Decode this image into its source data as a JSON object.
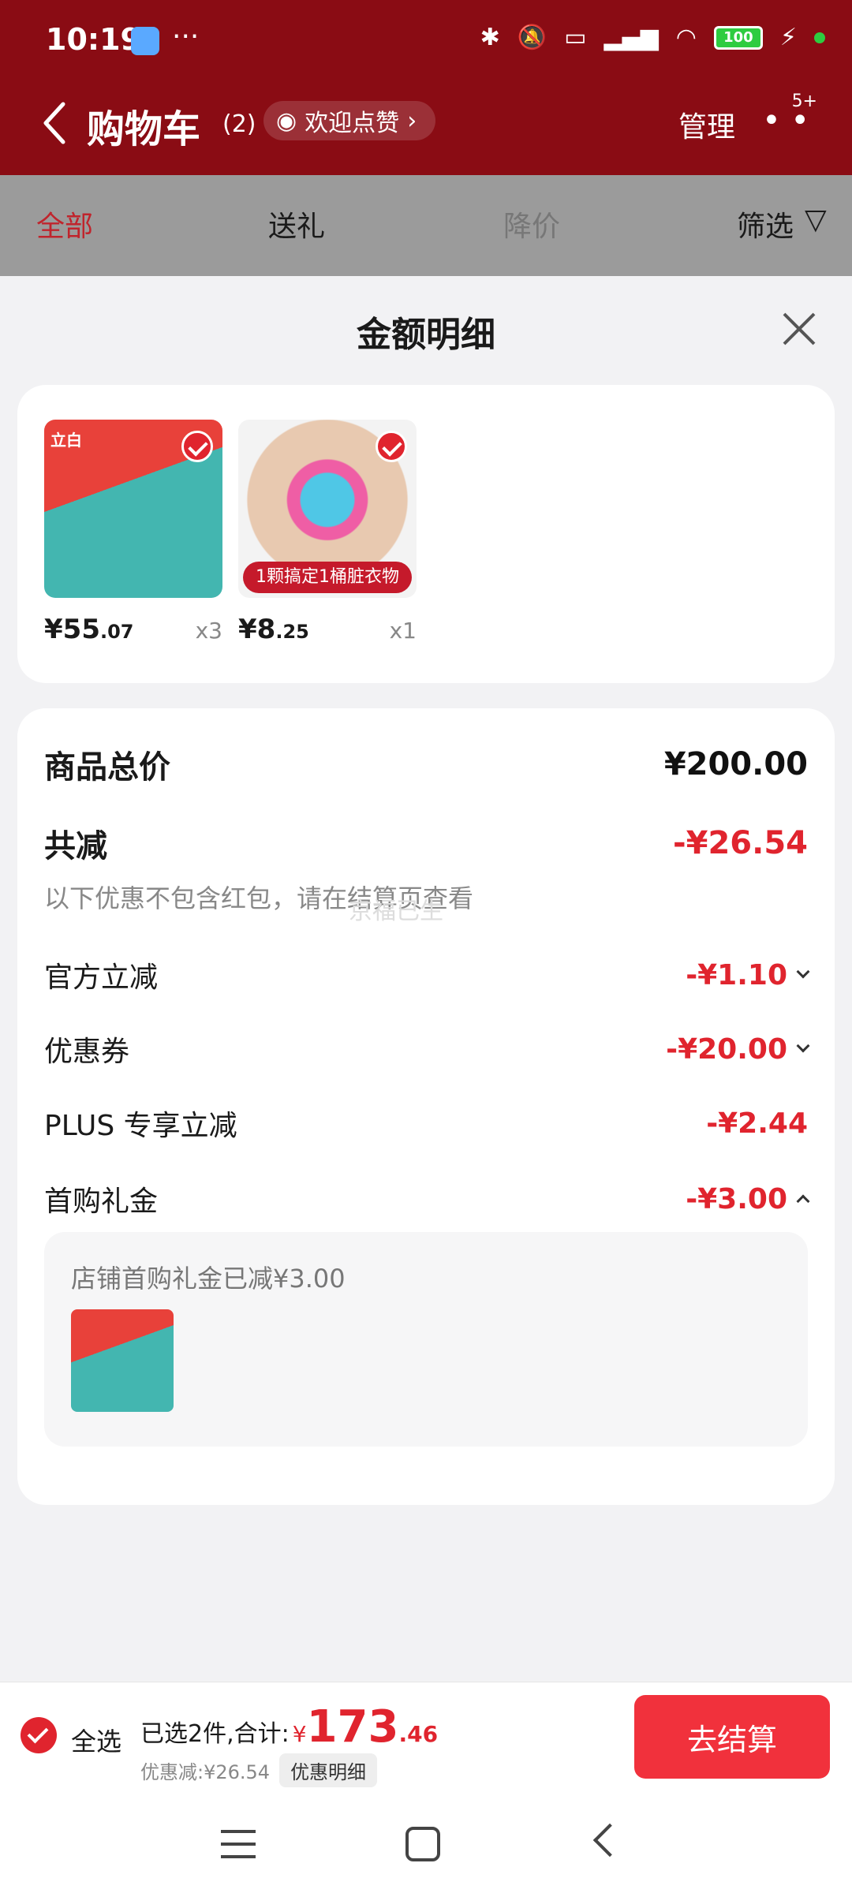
{
  "status_bar": {
    "time": "10:19",
    "dots": "···",
    "battery": "100"
  },
  "header": {
    "title": "购物车",
    "count": "(2)",
    "welcome": "欢迎点赞",
    "manage": "管理",
    "badge": "5+"
  },
  "tabs": {
    "all": "全部",
    "gift": "送礼",
    "price_drop": "降价",
    "filter": "筛选"
  },
  "sheet": {
    "title": "金额明细"
  },
  "products": [
    {
      "price_int": "¥55",
      "price_dec": ".07",
      "qty": "x3",
      "thumb_label": "立白"
    },
    {
      "price_int": "¥8",
      "price_dec": ".25",
      "qty": "x1",
      "banner": "1颗搞定1桶脏衣物"
    }
  ],
  "details": {
    "total_label": "商品总价",
    "total_value": "¥200.00",
    "reduce_label": "共减",
    "reduce_value": "-¥26.54",
    "note": "以下优惠不包含红包，请在结算页查看",
    "watermark": "京福已生",
    "items": [
      {
        "label": "官方立减",
        "value": "-¥1.10"
      },
      {
        "label": "优惠券",
        "value": "-¥20.00"
      },
      {
        "label": "PLUS 专享立减",
        "value": "-¥2.44"
      },
      {
        "label": "首购礼金",
        "value": "-¥3.00"
      }
    ],
    "gift_text": "店铺首购礼金已减¥3.00"
  },
  "bottom": {
    "select_all": "全选",
    "summary": "已选2件,合计:",
    "yen": "¥",
    "amount_int": "173",
    "amount_dec": ".46",
    "discount": "优惠减:¥26.54",
    "detail_btn": "优惠明细",
    "checkout": "去结算"
  },
  "colors": {
    "header_bg": "#8a0c14",
    "accent_red": "#e0242e",
    "checkout_bg": "#f1313c"
  }
}
